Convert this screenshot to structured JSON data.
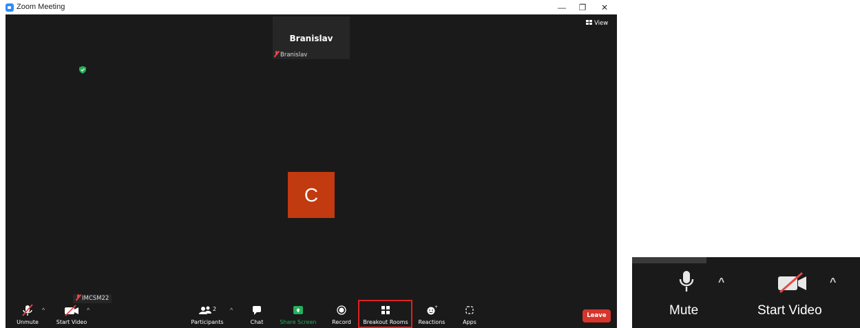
{
  "window": {
    "title": "Zoom Meeting",
    "minimize_glyph": "—",
    "restore_glyph": "❐",
    "close_glyph": "✕"
  },
  "meeting": {
    "active_speaker": "Branislav",
    "active_speaker_label": "Branislav",
    "view_label": "View",
    "avatar_letter": "C",
    "self_label": "IMCSM22"
  },
  "toolbar": {
    "unmute_label": "Unmute",
    "start_video_label": "Start Video",
    "participants_label": "Participants",
    "participants_count": "2",
    "chat_label": "Chat",
    "share_screen_label": "Share Screen",
    "record_label": "Record",
    "breakout_rooms_label": "Breakout Rooms",
    "reactions_label": "Reactions",
    "apps_label": "Apps",
    "leave_label": "Leave"
  },
  "inset": {
    "mute_label": "Mute",
    "start_video_label": "Start Video"
  },
  "colors": {
    "meeting_bg": "#1a1a1a",
    "avatar_bg": "#c23a0f",
    "share_green": "#23b05a",
    "leave_red": "#d5352b",
    "highlight_red": "#e02020",
    "muted_red": "#e94545"
  }
}
